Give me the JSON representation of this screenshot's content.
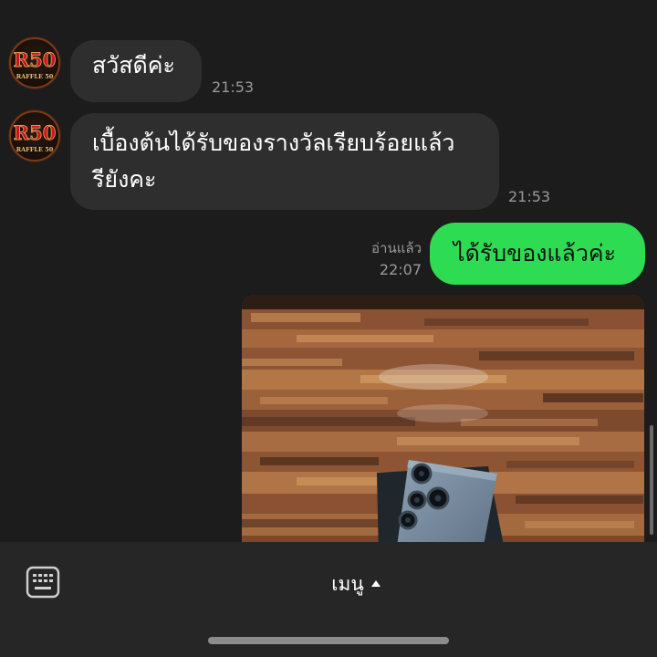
{
  "conversation": {
    "messages": [
      {
        "sender": "RAFFLE 50",
        "text": "สวัสดีค่ะ",
        "time": "21:53"
      },
      {
        "sender": "RAFFLE 50",
        "text_line1": "เบื้องต้นได้รับของรางวัลเรียบร้อยแล้ว",
        "text_line2": "รียังคะ",
        "time": "21:53"
      },
      {
        "sender": "me",
        "text": "ได้รับของแล้วค่ะ",
        "read_label": "อ่านแล้ว",
        "time": "22:07"
      }
    ],
    "photo_icon": "photo-phone-on-wood"
  },
  "avatar": {
    "logo_mark": "R50",
    "logo_text": "RAFFLE 50",
    "icon": "raffle50-logo"
  },
  "bottom_bar": {
    "keyboard_icon": "keyboard-icon",
    "menu_label": "เมนู",
    "menu_arrow_icon": "caret-up-icon"
  },
  "colors": {
    "background": "#1c1c1c",
    "incoming_bubble": "#2e2e2e",
    "outgoing_bubble": "#2ddc52",
    "bottom_bar": "#262626"
  }
}
